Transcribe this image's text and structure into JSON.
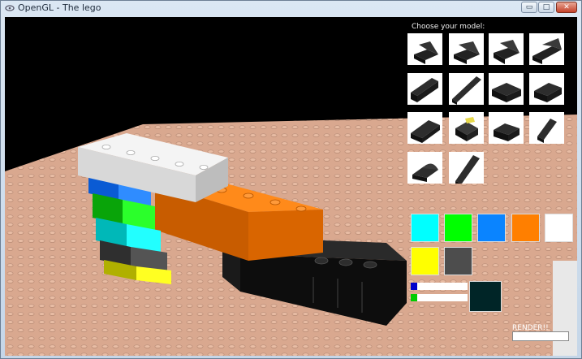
{
  "window": {
    "title": "OpenGL - The lego",
    "controls": {
      "minimize": "▭",
      "maximize": "□",
      "close": "✕"
    }
  },
  "panel": {
    "choose_label": "Choose your model:",
    "models": [
      "2x2 slope brick",
      "2x2 slope brick",
      "2x2 slope brick",
      "2x4 slope brick",
      "1x4 brick",
      "1x8 brick",
      "2x4 brick",
      "2x3 brick",
      "2x4 brick",
      "2x2 corner brick",
      "2x2 slope brick",
      "1x2 sloped brick",
      "2x2 curved brick",
      "1x6 sloped brick"
    ],
    "selected_model_index": 9,
    "colors": [
      "#00ffff",
      "#00ff00",
      "#0a84ff",
      "#ff7f00",
      "#ffffff",
      "#ffff00",
      "#4d4d4d"
    ],
    "slider_colors": [
      "#0000cc",
      "#00cc00"
    ],
    "preview_color": "#002527",
    "render_label": "RENDER!!",
    "render_value": ""
  },
  "scene": {
    "floor_color": "#d9a88f",
    "brick_colors": [
      "#ffffff",
      "#ff7f00",
      "#0a84ff",
      "#00ff00",
      "#00ffff",
      "#4d4d4d",
      "#ffff00",
      "#0a0a0a"
    ]
  }
}
